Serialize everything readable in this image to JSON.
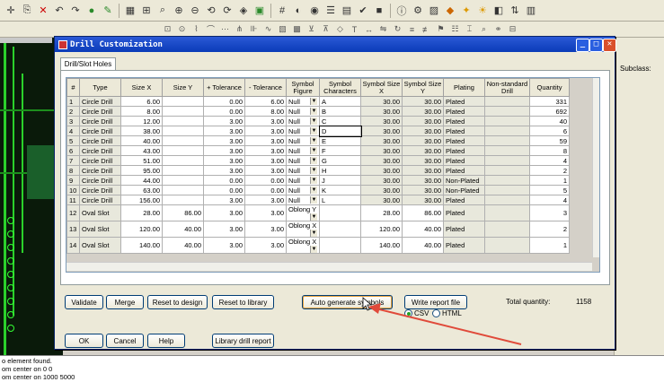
{
  "dialog": {
    "title": "Drill Customization",
    "tab_label": "Drill/Slot Holes",
    "columns": [
      "#",
      "Type",
      "Size X",
      "Size Y",
      "+ Tolerance",
      "- Tolerance",
      "Symbol Figure",
      "Symbol Characters",
      "Symbol Size X",
      "Symbol Size Y",
      "Plating",
      "Non-standard Drill",
      "Quantity"
    ],
    "rows": [
      [
        "1",
        "Circle Drill",
        "6.00",
        "",
        "0.00",
        "6.00",
        "Null",
        "A",
        "30.00",
        "30.00",
        "Plated",
        "",
        "331"
      ],
      [
        "2",
        "Circle Drill",
        "8.00",
        "",
        "0.00",
        "8.00",
        "Null",
        "B",
        "30.00",
        "30.00",
        "Plated",
        "",
        "692"
      ],
      [
        "3",
        "Circle Drill",
        "12.00",
        "",
        "3.00",
        "3.00",
        "Null",
        "C",
        "30.00",
        "30.00",
        "Plated",
        "",
        "40"
      ],
      [
        "4",
        "Circle Drill",
        "38.00",
        "",
        "3.00",
        "3.00",
        "Null",
        "D",
        "30.00",
        "30.00",
        "Plated",
        "",
        "6"
      ],
      [
        "5",
        "Circle Drill",
        "40.00",
        "",
        "3.00",
        "3.00",
        "Null",
        "E",
        "30.00",
        "30.00",
        "Plated",
        "",
        "59"
      ],
      [
        "6",
        "Circle Drill",
        "43.00",
        "",
        "3.00",
        "3.00",
        "Null",
        "F",
        "30.00",
        "30.00",
        "Plated",
        "",
        "8"
      ],
      [
        "7",
        "Circle Drill",
        "51.00",
        "",
        "3.00",
        "3.00",
        "Null",
        "G",
        "30.00",
        "30.00",
        "Plated",
        "",
        "4"
      ],
      [
        "8",
        "Circle Drill",
        "95.00",
        "",
        "3.00",
        "3.00",
        "Null",
        "H",
        "30.00",
        "30.00",
        "Plated",
        "",
        "2"
      ],
      [
        "9",
        "Circle Drill",
        "44.00",
        "",
        "0.00",
        "0.00",
        "Null",
        "J",
        "30.00",
        "30.00",
        "Non-Plated",
        "",
        "1"
      ],
      [
        "10",
        "Circle Drill",
        "63.00",
        "",
        "0.00",
        "0.00",
        "Null",
        "K",
        "30.00",
        "30.00",
        "Non-Plated",
        "",
        "5"
      ],
      [
        "11",
        "Circle Drill",
        "156.00",
        "",
        "3.00",
        "3.00",
        "Null",
        "L",
        "30.00",
        "30.00",
        "Plated",
        "",
        "4"
      ],
      [
        "12",
        "Oval Slot",
        "28.00",
        "86.00",
        "3.00",
        "3.00",
        "Oblong Y",
        "",
        "28.00",
        "86.00",
        "Plated",
        "",
        "3"
      ],
      [
        "13",
        "Oval Slot",
        "120.00",
        "40.00",
        "3.00",
        "3.00",
        "Oblong X",
        "",
        "120.00",
        "40.00",
        "Plated",
        "",
        "2"
      ],
      [
        "14",
        "Oval Slot",
        "140.00",
        "40.00",
        "3.00",
        "3.00",
        "Oblong X",
        "",
        "140.00",
        "40.00",
        "Plated",
        "",
        "1"
      ]
    ],
    "buttons": {
      "validate": "Validate",
      "merge": "Merge",
      "reset_design": "Reset to design",
      "reset_library": "Reset to library",
      "auto_generate": "Auto generate symbols",
      "write_report": "Write report file",
      "ok": "OK",
      "cancel": "Cancel",
      "help": "Help",
      "library_report": "Library drill report"
    },
    "total_label": "Total quantity:",
    "total_value": "1158",
    "radio_csv": "CSV",
    "radio_html": "HTML"
  },
  "right_panel": {
    "subclass_label": "Subclass:"
  },
  "console": {
    "lines": [
      "o element found.",
      "om center on 0 0",
      "om center on 1000 5000"
    ]
  },
  "colors": {
    "accent": "#e04a3a",
    "title_bar": "#0a3bb8"
  }
}
